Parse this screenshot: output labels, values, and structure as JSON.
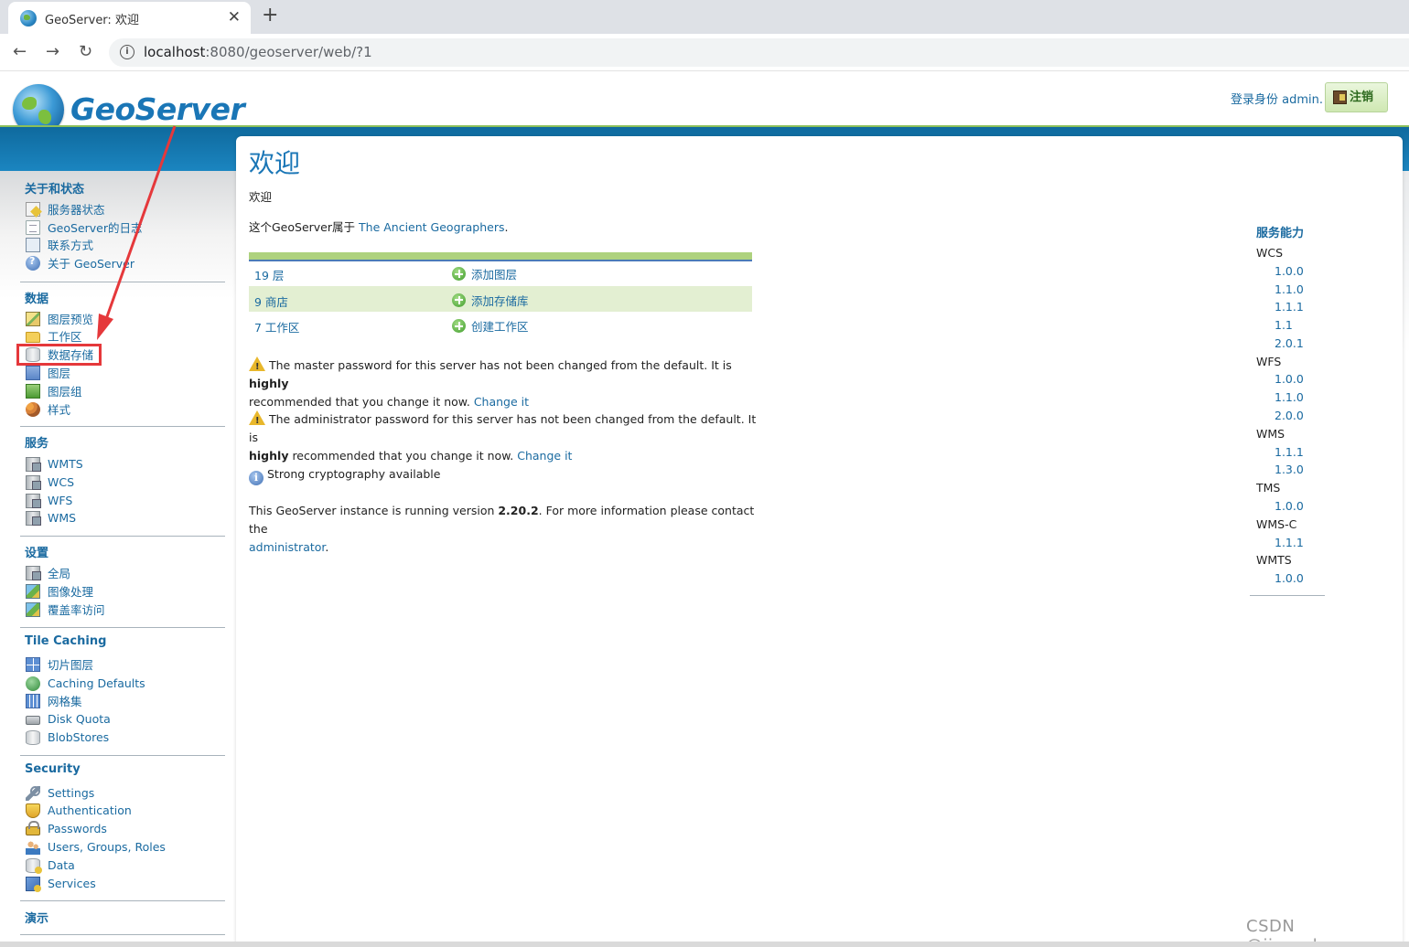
{
  "browser": {
    "tab_title": "GeoServer: 欢迎",
    "tab_close": "✕",
    "new_tab": "+",
    "url_host": "localhost",
    "url_rest": ":8080/geoserver/web/?1",
    "back": "←",
    "forward": "→",
    "reload": "↻"
  },
  "header": {
    "logo_text": "GeoServer",
    "login_info": "登录身份 admin.",
    "logout_label": "注销"
  },
  "sidebar": {
    "sections": [
      {
        "title": "关于和状态",
        "items": [
          {
            "label": "服务器状态",
            "icon": "server-status-icon"
          },
          {
            "label": "GeoServer的日志",
            "icon": "log-icon"
          },
          {
            "label": "联系方式",
            "icon": "contact-icon"
          },
          {
            "label": "关于 GeoServer",
            "icon": "about-icon"
          }
        ]
      },
      {
        "title": "数据",
        "items": [
          {
            "label": "图层预览",
            "icon": "layer-preview-icon"
          },
          {
            "label": "工作区",
            "icon": "folder-icon"
          },
          {
            "label": "数据存储",
            "icon": "datastore-icon"
          },
          {
            "label": "图层",
            "icon": "layer-icon"
          },
          {
            "label": "图层组",
            "icon": "layer-group-icon"
          },
          {
            "label": "样式",
            "icon": "style-icon"
          }
        ]
      },
      {
        "title": "服务",
        "items": [
          {
            "label": "WMTS",
            "icon": "service-icon"
          },
          {
            "label": "WCS",
            "icon": "service-icon"
          },
          {
            "label": "WFS",
            "icon": "service-icon"
          },
          {
            "label": "WMS",
            "icon": "service-icon"
          }
        ]
      },
      {
        "title": "设置",
        "items": [
          {
            "label": "全局",
            "icon": "global-settings-icon"
          },
          {
            "label": "图像处理",
            "icon": "image-processing-icon"
          },
          {
            "label": "覆盖率访问",
            "icon": "coverage-access-icon"
          }
        ]
      },
      {
        "title": "Tile Caching",
        "items": [
          {
            "label": "切片图层",
            "icon": "tile-layers-icon"
          },
          {
            "label": "Caching Defaults",
            "icon": "globe-icon"
          },
          {
            "label": "网格集",
            "icon": "gridset-icon"
          },
          {
            "label": "Disk Quota",
            "icon": "disk-icon"
          },
          {
            "label": "BlobStores",
            "icon": "blobstore-icon"
          }
        ]
      },
      {
        "title": "Security",
        "items": [
          {
            "label": "Settings",
            "icon": "wrench-icon"
          },
          {
            "label": "Authentication",
            "icon": "shield-icon"
          },
          {
            "label": "Passwords",
            "icon": "lock-icon"
          },
          {
            "label": "Users, Groups, Roles",
            "icon": "users-icon"
          },
          {
            "label": "Data",
            "icon": "data-security-icon"
          },
          {
            "label": "Services",
            "icon": "services-security-icon"
          }
        ]
      },
      {
        "title": "演示",
        "items": []
      }
    ]
  },
  "main": {
    "title": "欢迎",
    "subtitle": "欢迎",
    "owner_prefix": "这个GeoServer属于",
    "owner_name": "The Ancient Geographers",
    "owner_suffix": ".",
    "summary": [
      {
        "count": "19 层",
        "action": "添加图层"
      },
      {
        "count": "9 商店",
        "action": "添加存储库"
      },
      {
        "count": "7 工作区",
        "action": "创建工作区"
      }
    ],
    "warn_master_1": "The master password for this server has not been changed from the default. It is ",
    "warn_master_bold": "highly",
    "warn_master_2": "recommended that you change it now.",
    "warn_admin_1": "The administrator password for this server has not been changed from the default. It is",
    "warn_admin_bold": "highly",
    "warn_admin_2": " recommended that you change it now.",
    "change_link": "Change it",
    "crypto": "Strong cryptography available",
    "version_1": "This GeoServer instance is running version ",
    "version_num": "2.20.2",
    "version_2": ". For more information please contact the",
    "admin_link": "administrator",
    "period": "."
  },
  "capabilities": {
    "title": "服务能力",
    "services": [
      {
        "name": "WCS",
        "versions": [
          "1.0.0",
          "1.1.0",
          "1.1.1",
          "1.1",
          "2.0.1"
        ]
      },
      {
        "name": "WFS",
        "versions": [
          "1.0.0",
          "1.1.0",
          "2.0.0"
        ]
      },
      {
        "name": "WMS",
        "versions": [
          "1.1.1",
          "1.3.0"
        ]
      },
      {
        "name": "TMS",
        "versions": [
          "1.0.0"
        ]
      },
      {
        "name": "WMS-C",
        "versions": [
          "1.1.1"
        ]
      },
      {
        "name": "WMTS",
        "versions": [
          "1.0.0"
        ]
      }
    ]
  },
  "watermark": "CSDN @jing_zhong",
  "colors": {
    "accent": "#1a6aa0",
    "band": "#1b85c0",
    "summary_bar": "#aed27e",
    "highlight": "#e5383b"
  }
}
